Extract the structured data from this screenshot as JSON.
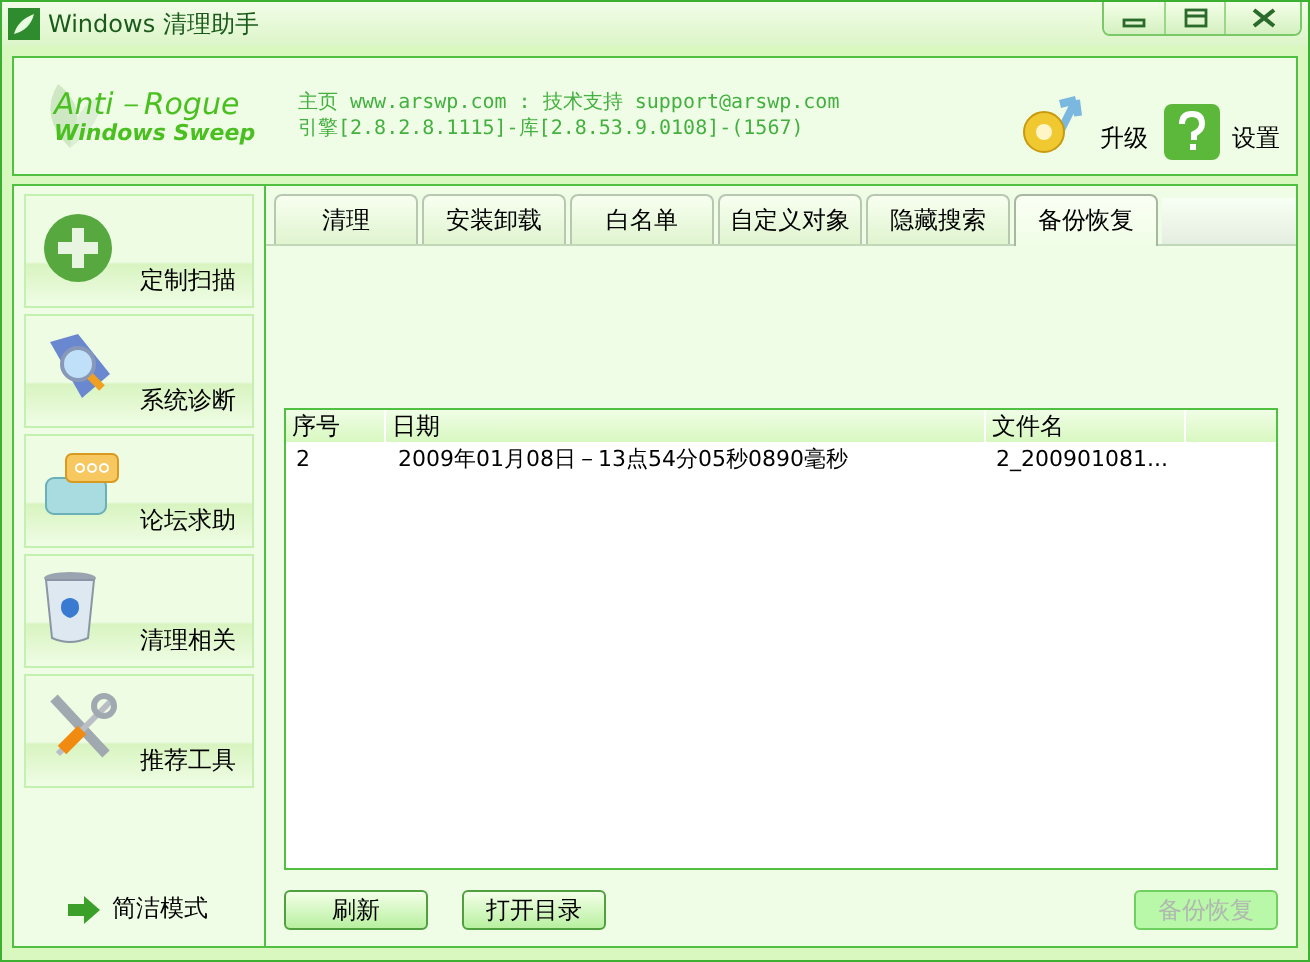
{
  "window": {
    "title": "Windows 清理助手"
  },
  "header": {
    "logo_line_1": "Anti－Rogue",
    "logo_line_2": "Windows Sweep",
    "info_line_1": "主页 www.arswp.com : 技术支持 support@arswp.com",
    "info_line_2": "引擎[2.8.2.8.1115]-库[2.8.53.9.0108]-(1567)",
    "actions": [
      {
        "label": "升级",
        "kind": "upgrade"
      },
      {
        "label": "设置",
        "kind": "settings"
      }
    ]
  },
  "sidebar": {
    "items": [
      {
        "label": "定制扫描",
        "kind": "plus"
      },
      {
        "label": "系统诊断",
        "kind": "magnifier"
      },
      {
        "label": "论坛求助",
        "kind": "chat"
      },
      {
        "label": "清理相关",
        "kind": "bin"
      },
      {
        "label": "推荐工具",
        "kind": "tools"
      }
    ],
    "mode_link": "简洁模式"
  },
  "tabs": [
    {
      "label": "清理",
      "selected": false
    },
    {
      "label": "安装卸载",
      "selected": false
    },
    {
      "label": "白名单",
      "selected": false
    },
    {
      "label": "自定义对象",
      "selected": false
    },
    {
      "label": "隐藏搜索",
      "selected": false
    },
    {
      "label": "备份恢复",
      "selected": true
    }
  ],
  "table": {
    "columns": [
      "序号",
      "日期",
      "文件名"
    ],
    "rows": [
      [
        "2",
        "2009年01月08日－13点54分05秒0890毫秒",
        "2_200901081..."
      ]
    ]
  },
  "buttons": [
    {
      "label": "刷新",
      "disabled": false
    },
    {
      "label": "打开目录",
      "disabled": false
    },
    {
      "label": "备份恢复",
      "disabled": true
    }
  ]
}
